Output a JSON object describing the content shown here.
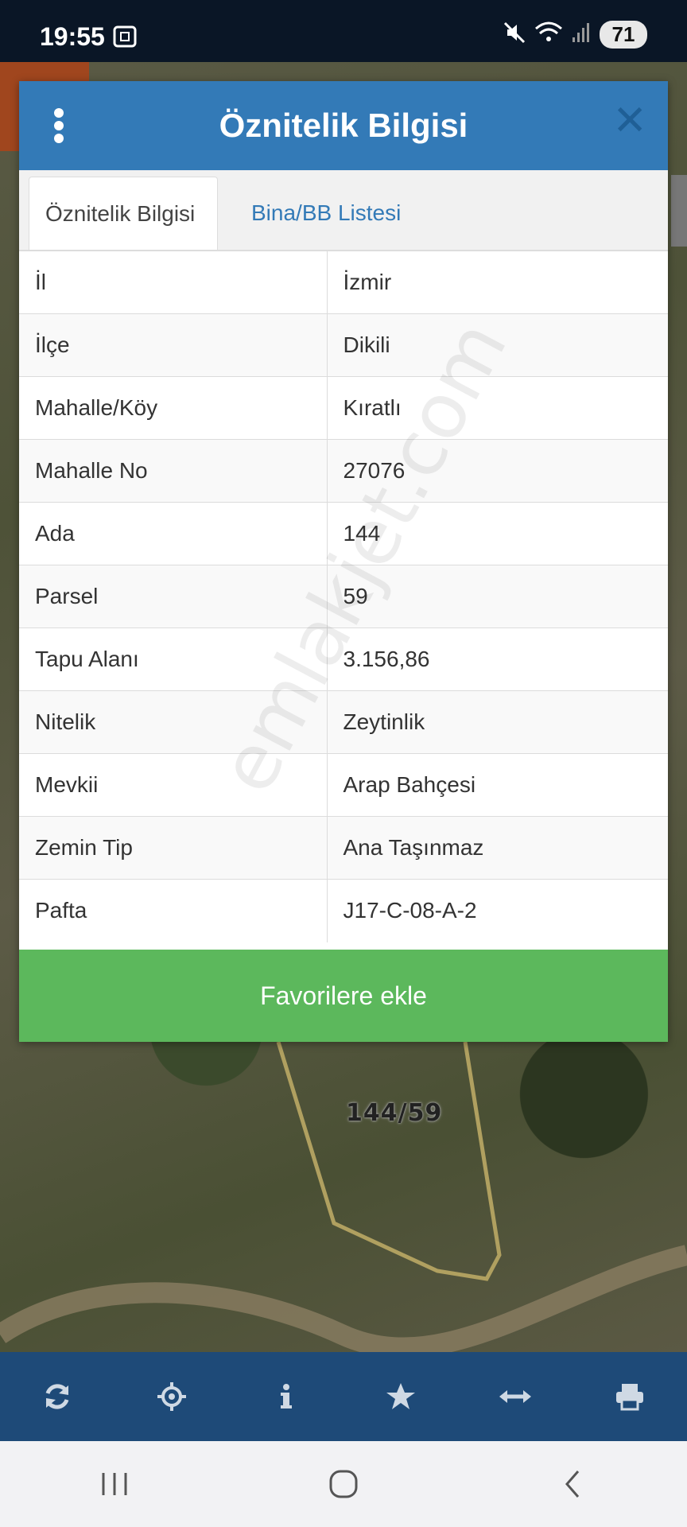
{
  "status_bar": {
    "time": "19:55",
    "battery": "71"
  },
  "dialog": {
    "title": "Öznitelik Bilgisi",
    "tabs": [
      {
        "label": "Öznitelik Bilgisi",
        "active": true
      },
      {
        "label": "Bina/BB Listesi",
        "active": false
      }
    ],
    "rows": [
      {
        "key": "İl",
        "value": "İzmir"
      },
      {
        "key": "İlçe",
        "value": "Dikili"
      },
      {
        "key": "Mahalle/Köy",
        "value": "Kıratlı"
      },
      {
        "key": "Mahalle No",
        "value": "27076"
      },
      {
        "key": "Ada",
        "value": "144"
      },
      {
        "key": "Parsel",
        "value": "59"
      },
      {
        "key": "Tapu Alanı",
        "value": "3.156,86"
      },
      {
        "key": "Nitelik",
        "value": "Zeytinlik"
      },
      {
        "key": "Mevkii",
        "value": "Arap Bahçesi"
      },
      {
        "key": "Zemin Tip",
        "value": "Ana Taşınmaz"
      },
      {
        "key": "Pafta",
        "value": "J17-C-08-A-2"
      }
    ],
    "favorite_button": "Favorilere ekle"
  },
  "watermark": "emlakjet.com",
  "map": {
    "parcel_label": "144/59"
  },
  "toolbar": {
    "icons": [
      "refresh-icon",
      "locate-icon",
      "info-icon",
      "star-icon",
      "measure-icon",
      "print-icon"
    ]
  },
  "colors": {
    "header": "#337ab7",
    "button": "#5cb85c",
    "toolbar": "#1e4a78"
  }
}
